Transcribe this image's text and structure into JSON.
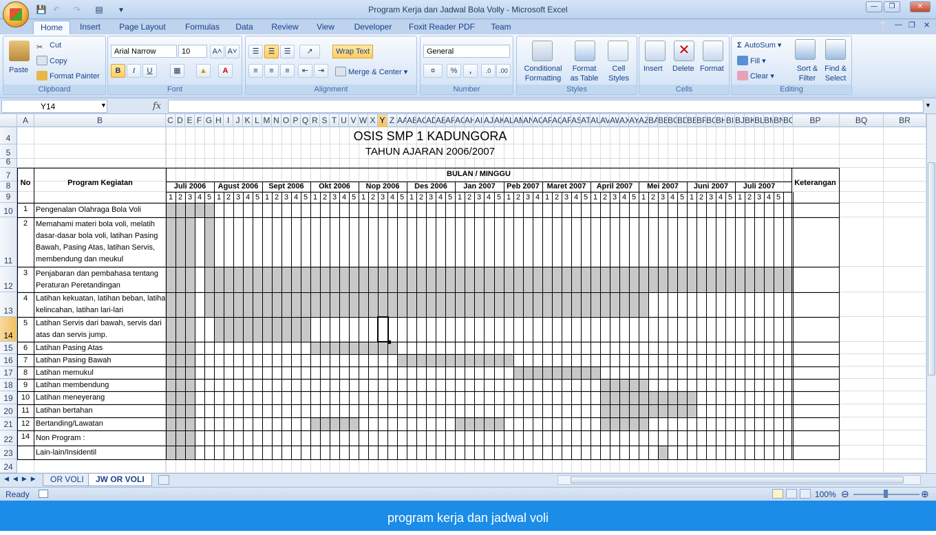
{
  "window": {
    "title": "Program Kerja dan Jadwal Bola Volly - Microsoft Excel"
  },
  "tabs": [
    "Home",
    "Insert",
    "Page Layout",
    "Formulas",
    "Data",
    "Review",
    "View",
    "Developer",
    "Foxit Reader PDF",
    "Team"
  ],
  "ribbon": {
    "clipboard": {
      "label": "Clipboard",
      "paste": "Paste",
      "cut": "Cut",
      "copy": "Copy",
      "format_painter": "Format Painter"
    },
    "font": {
      "label": "Font",
      "name": "Arial Narrow",
      "size": "10",
      "bold": "B",
      "italic": "I",
      "underline": "U"
    },
    "alignment": {
      "label": "Alignment",
      "wrap_text": "Wrap Text",
      "merge_center": "Merge & Center"
    },
    "number": {
      "label": "Number",
      "format": "General",
      "percent": "%",
      "comma": ","
    },
    "styles": {
      "label": "Styles",
      "conditional_1": "Conditional",
      "conditional_2": "Formatting",
      "format_table_1": "Format",
      "format_table_2": "as Table",
      "cell_styles_1": "Cell",
      "cell_styles_2": "Styles"
    },
    "cells": {
      "label": "Cells",
      "insert": "Insert",
      "delete": "Delete",
      "format": "Format"
    },
    "editing": {
      "label": "Editing",
      "autosum": "AutoSum",
      "fill": "Fill",
      "clear": "Clear",
      "sort_1": "Sort &",
      "sort_2": "Filter",
      "find_1": "Find &",
      "find_2": "Select"
    }
  },
  "formula_bar": {
    "name_box": "Y14",
    "fx": "fx",
    "value": ""
  },
  "columns_left": [
    "A",
    "B"
  ],
  "columns_week": [
    "C",
    "D",
    "E",
    "F",
    "G",
    "H",
    "I",
    "J",
    "K",
    "L",
    "M",
    "N",
    "O",
    "P",
    "Q",
    "R",
    "S",
    "T",
    "U",
    "V",
    "W",
    "X",
    "Y",
    "Z",
    "AA",
    "AB",
    "AC",
    "AD",
    "AE",
    "AF",
    "AG",
    "AH",
    "AI",
    "AJ",
    "AK",
    "AL",
    "AM",
    "AN",
    "AO",
    "AP",
    "AQ",
    "AR",
    "AS",
    "AT",
    "AU",
    "AV",
    "AW",
    "AX",
    "AY",
    "AZ",
    "BA",
    "BB",
    "BC",
    "BD",
    "BE",
    "BF",
    "BG",
    "BH",
    "BI",
    "BJ",
    "BK",
    "BL",
    "BM",
    "BN",
    "BO"
  ],
  "columns_right": [
    "BP",
    "BQ",
    "BR"
  ],
  "sheet": {
    "title": "OSIS SMP 1 KADUNGORA",
    "subtitle": "TAHUN AJARAN 2006/2007",
    "header_no": "No",
    "header_program": "Program Kegiatan",
    "header_bulan": "BULAN / MINGGU",
    "header_ket": "Keterangan",
    "months": [
      {
        "name": "Juli 2006",
        "weeks": 5
      },
      {
        "name": "Agust 2006",
        "weeks": 5
      },
      {
        "name": "Sept 2006",
        "weeks": 5
      },
      {
        "name": "Okt 2006",
        "weeks": 5
      },
      {
        "name": "Nop 2006",
        "weeks": 5
      },
      {
        "name": "Des 2006",
        "weeks": 5
      },
      {
        "name": "Jan 2007",
        "weeks": 5
      },
      {
        "name": "Peb 2007",
        "weeks": 4
      },
      {
        "name": "Maret  2007",
        "weeks": 5
      },
      {
        "name": "April 2007",
        "weeks": 5
      },
      {
        "name": "Mei 2007",
        "weeks": 5
      },
      {
        "name": "Juni 2007",
        "weeks": 5
      },
      {
        "name": "Juli 2007",
        "weeks": 5
      }
    ],
    "rows": [
      {
        "row": "10",
        "no": "1",
        "program": [
          "Pengenalan Olahraga Bola Voli"
        ],
        "shade": [
          [
            0,
            4
          ]
        ]
      },
      {
        "row": "11",
        "no": "2",
        "program": [
          "Memahami materi bola voli, melatih",
          "dasar-dasar bola voli, latihan Pasing",
          "Bawah, Pasing Atas, latihan Servis,",
          "membendung dan meukul"
        ],
        "shade": [
          [
            0,
            2
          ],
          [
            4,
            4
          ]
        ]
      },
      {
        "row": "12",
        "no": "3",
        "program": [
          "Penjabaran dan pembahasa tentang",
          "Peraturan Peretandingan"
        ],
        "shade": [
          [
            0,
            2
          ],
          [
            4,
            64
          ]
        ]
      },
      {
        "row": "13",
        "no": "4",
        "program": [
          "Latihan kekuatan, latihan beban, latihan",
          "kelincahan, latihan lari-lari"
        ],
        "shade": [
          [
            0,
            2
          ],
          [
            4,
            49
          ]
        ]
      },
      {
        "row": "14",
        "no": "5",
        "program": [
          "Latihan Servis dari bawah, servis dari",
          "atas dan servis jump."
        ],
        "shade": [
          [
            0,
            2
          ],
          [
            5,
            14
          ]
        ]
      },
      {
        "row": "15",
        "no": "6",
        "program": [
          "Latihan Pasing Atas"
        ],
        "shade": [
          [
            0,
            2
          ],
          [
            15,
            23
          ]
        ]
      },
      {
        "row": "16",
        "no": "7",
        "program": [
          "Latihan Pasing Bawah"
        ],
        "shade": [
          [
            0,
            2
          ],
          [
            24,
            35
          ]
        ]
      },
      {
        "row": "17",
        "no": "8",
        "program": [
          "Latihan memukul"
        ],
        "shade": [
          [
            0,
            2
          ],
          [
            36,
            44
          ]
        ]
      },
      {
        "row": "18",
        "no": "9",
        "program": [
          "Latihan membendung"
        ],
        "shade": [
          [
            0,
            2
          ],
          [
            45,
            49
          ]
        ]
      },
      {
        "row": "19",
        "no": "10",
        "program": [
          "Latihan meneyerang"
        ],
        "shade": [
          [
            0,
            2
          ],
          [
            45,
            54
          ]
        ]
      },
      {
        "row": "20",
        "no": "11",
        "program": [
          "Latihan bertahan"
        ],
        "shade": [
          [
            0,
            2
          ],
          [
            45,
            54
          ]
        ]
      },
      {
        "row": "21",
        "no": "12",
        "program": [
          "Bertanding/Lawatan"
        ],
        "shade": [
          [
            0,
            2
          ],
          [
            15,
            19
          ],
          [
            30,
            34
          ],
          [
            45,
            49
          ]
        ]
      },
      {
        "row": "22",
        "no": "14",
        "program": [
          "Non Program :"
        ],
        "shade": [
          [
            0,
            2
          ]
        ]
      },
      {
        "row": "23",
        "no": "",
        "program": [
          "Lain-lain/Insidentil"
        ],
        "shade": [
          [
            0,
            2
          ],
          [
            51,
            51
          ]
        ]
      }
    ]
  },
  "sheet_tabs": [
    "OR VOLI",
    "JW OR VOLI"
  ],
  "status": {
    "ready": "Ready",
    "zoom": "100%"
  },
  "caption": "program kerja dan jadwal voli"
}
